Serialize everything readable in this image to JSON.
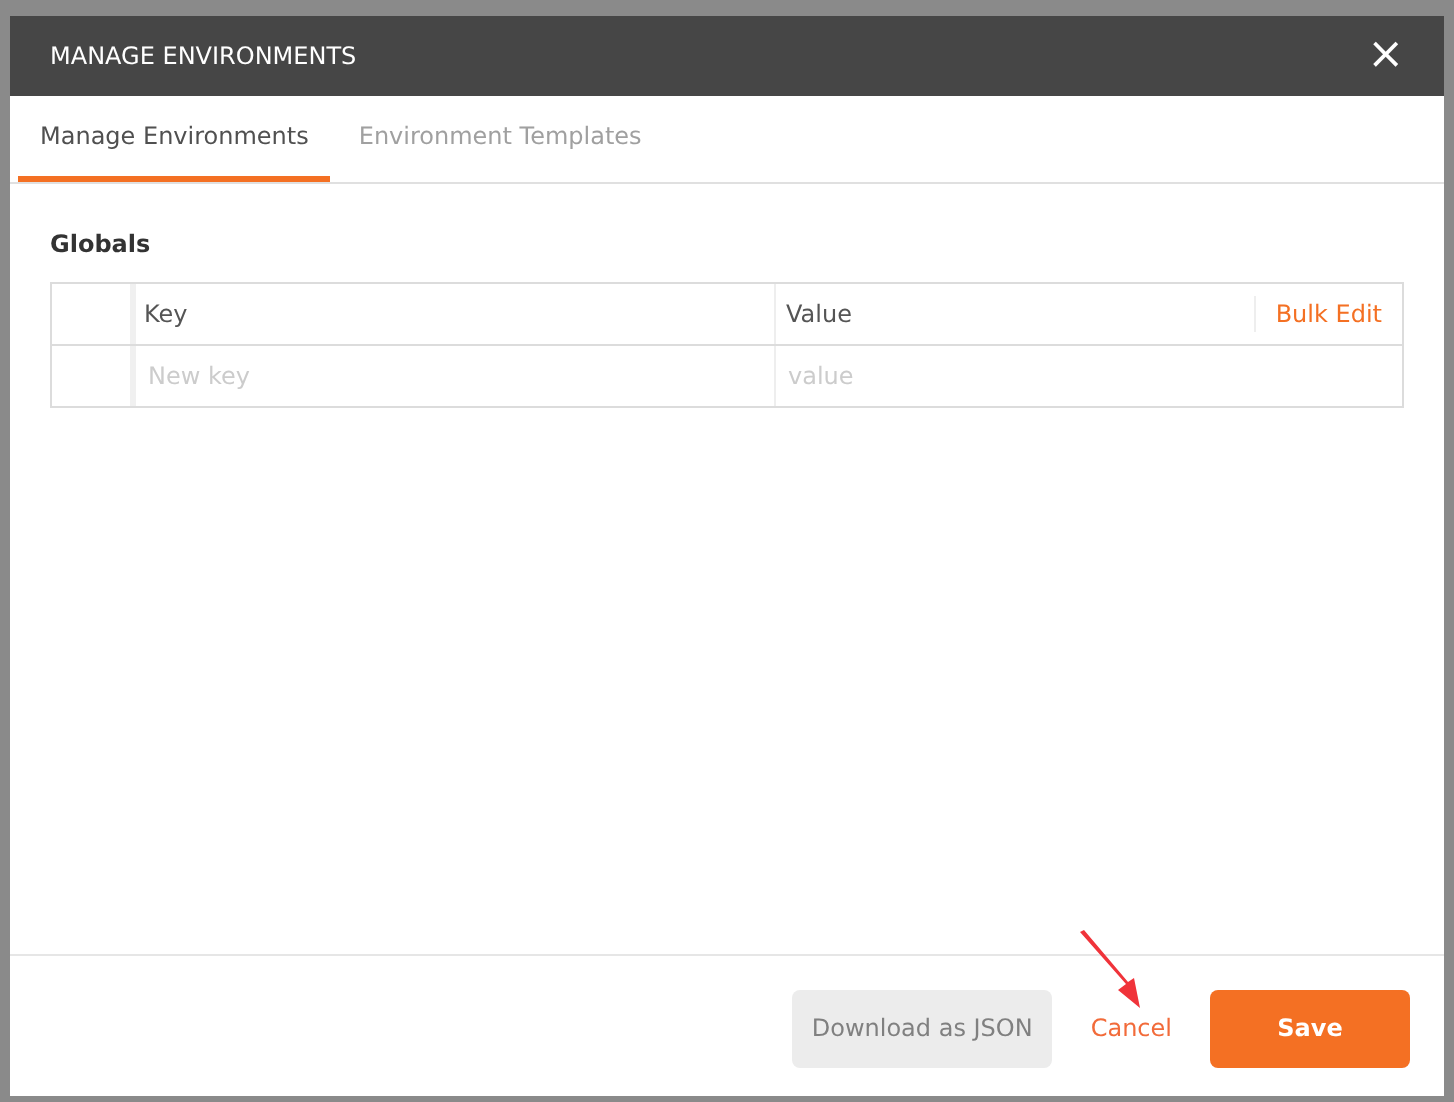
{
  "dialog": {
    "title": "MANAGE ENVIRONMENTS",
    "close": "×"
  },
  "tabs": [
    {
      "label": "Manage Environments",
      "selected": true
    },
    {
      "label": "Environment Templates",
      "selected": false
    }
  ],
  "section_title": "Globals",
  "table": {
    "columns": [
      "Key",
      "Value"
    ],
    "action": "Bulk Edit",
    "new_row": {
      "key_placeholder": "New key",
      "value_placeholder": "value"
    }
  },
  "footer": {
    "buttons": [
      {
        "label": "Download as JSON",
        "kind": "secondary"
      },
      {
        "label": "Cancel",
        "kind": "link"
      },
      {
        "label": "Save",
        "kind": "primary"
      }
    ]
  }
}
